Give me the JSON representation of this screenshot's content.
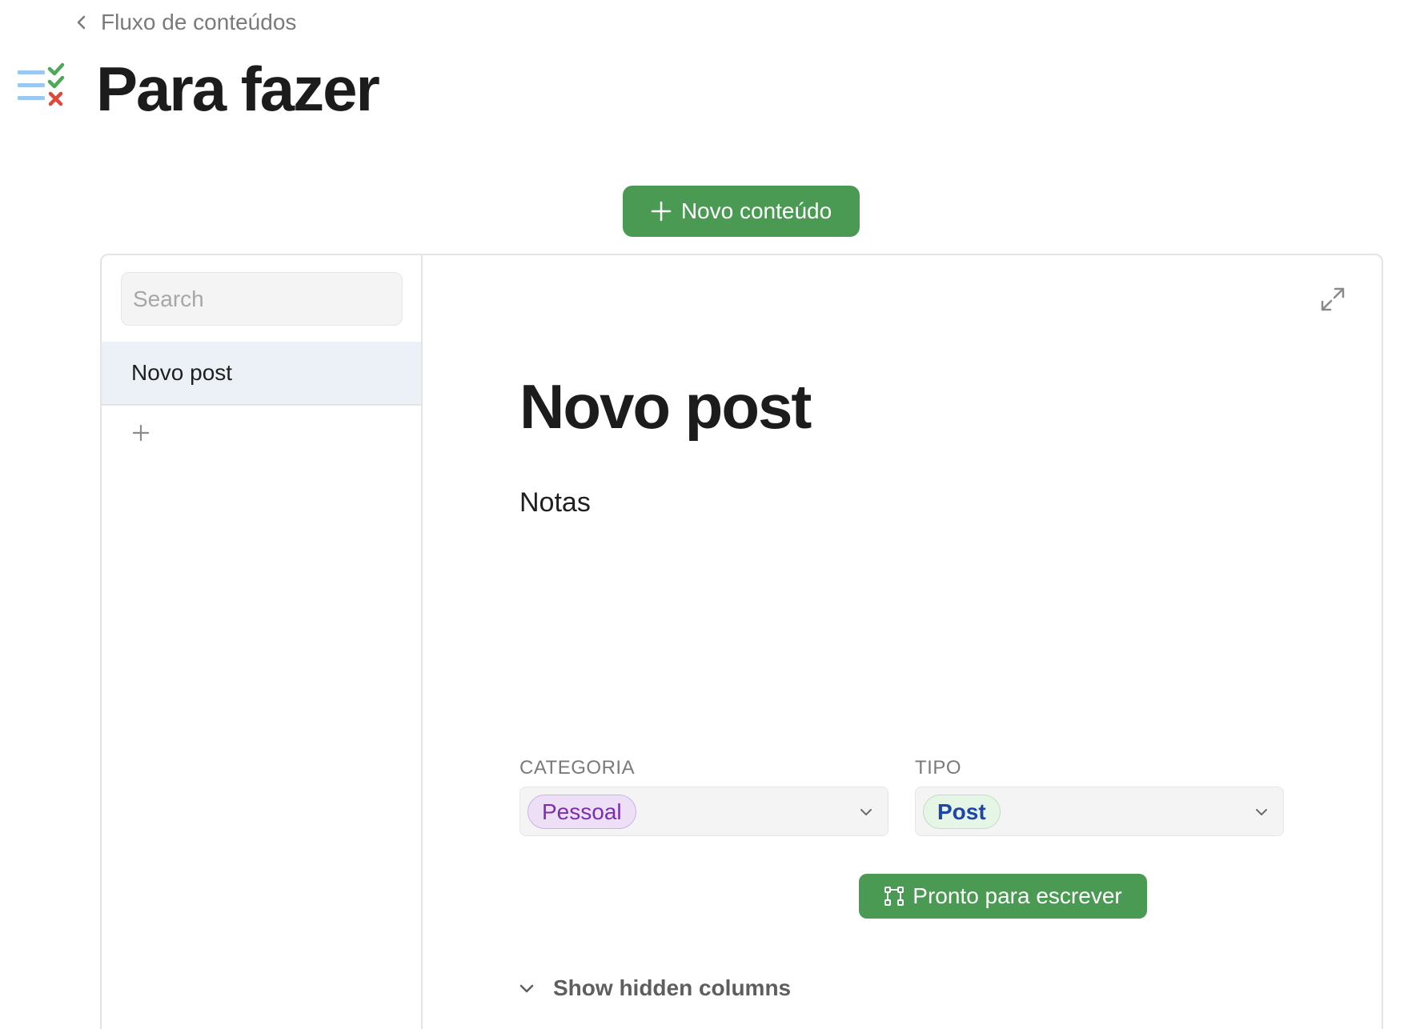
{
  "breadcrumb": {
    "label": "Fluxo de conteúdos",
    "icon": "chevron-left-icon"
  },
  "header": {
    "title": "Para fazer",
    "icon": "checklist-icon"
  },
  "toolbar": {
    "new_content_label": "Novo conteúdo",
    "new_content_icon": "plus-icon"
  },
  "sidebar": {
    "search": {
      "placeholder": "Search",
      "value": ""
    },
    "items": [
      {
        "label": "Novo post",
        "selected": true
      }
    ],
    "add_icon": "plus-icon"
  },
  "detail": {
    "title": "Novo post",
    "notes_label": "Notas",
    "expand_icon": "expand-icon",
    "fields": {
      "categoria": {
        "label": "CATEGORIA",
        "value": "Pessoal"
      },
      "tipo": {
        "label": "TIPO",
        "value": "Post"
      }
    },
    "action_label": "Pronto para escrever",
    "action_icon": "workflow-icon",
    "show_hidden_label": "Show hidden columns"
  },
  "colors": {
    "accent_green": "#4b9a54",
    "tag_pessoal_bg": "#ede0f6",
    "tag_pessoal_text": "#7b2fb0",
    "tag_post_bg": "#e5f5e6",
    "tag_post_text": "#1f45a8",
    "selected_row_bg": "#ebf1f7"
  }
}
